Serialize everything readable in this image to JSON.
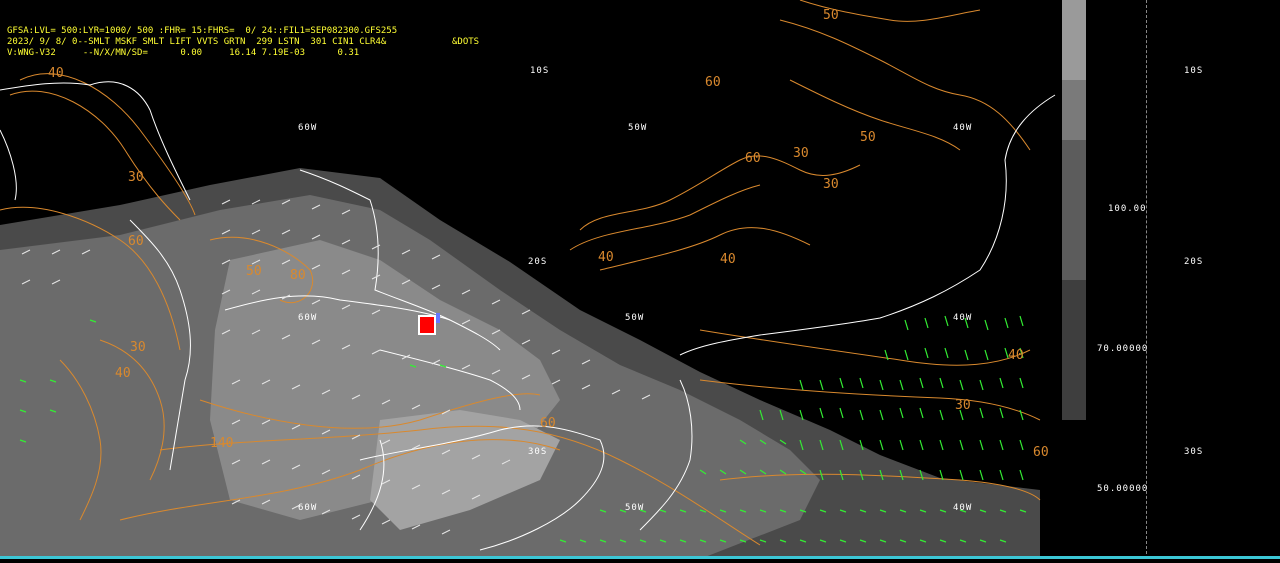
{
  "header": {
    "line1": "GFSA:LVL= 500:LYR=1000/ 500 :FHR= 15:FHRS=  0/ 24::FIL1=SEP082300.GFS255",
    "line2": "2023/ 9/ 8/ 0--SMLT MSKF SMLT LIFT VVTS GRTN  299 LSTN  301 CIN1 CLR4&",
    "line2_tag": "&DOTS",
    "line3": "V:WNG-V32     --N/X/MN/SD=      0.00     16.14 7.19E-03      0.31"
  },
  "map_labels": {
    "lat_10s": "10S",
    "lat_20s": "20S",
    "lat_30s": "30S",
    "lon_40w": "40W",
    "lon_50w": "50W",
    "lon_60w": "60W"
  },
  "contour_labels": [
    "40",
    "30",
    "60",
    "50",
    "80",
    "140",
    "60",
    "30",
    "40",
    "60",
    "50",
    "30",
    "40",
    "60",
    "50",
    "40",
    "30",
    "60",
    "40",
    "30"
  ],
  "side_panel": {
    "lat_10s": "10S",
    "lat_20s": "20S",
    "lat_30s": "30S",
    "scale_top": "100.00",
    "scale_mid": "70.00000",
    "scale_low": "50.00000"
  },
  "colors": {
    "background": "#000000",
    "header_text": "#ffff33",
    "coast": "#ffffff",
    "contour": "#d9892e",
    "wind_green": "#33ee33",
    "shade_dark": "#4a4a4a",
    "shade_light": "#9a9a9a",
    "station": "#ff0000"
  }
}
